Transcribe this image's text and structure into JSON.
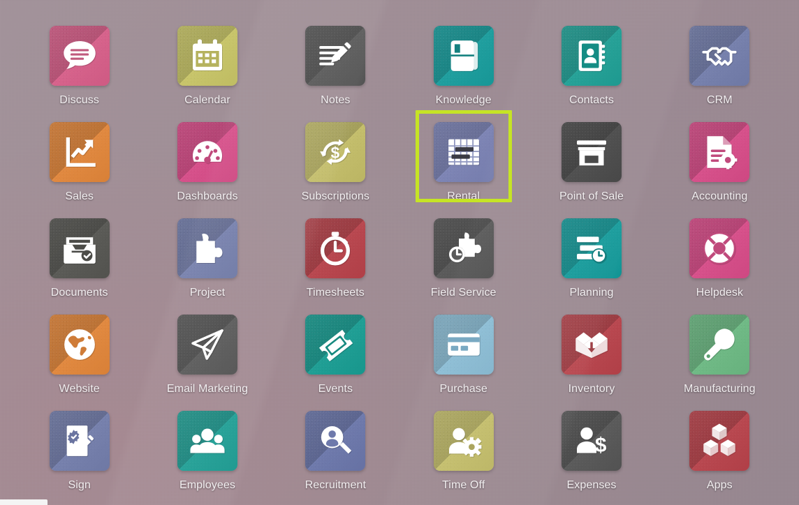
{
  "desktop": {
    "background_color": "#9e8c94",
    "highlight_color": "#c6e425",
    "label_color": "#f2eef0"
  },
  "apps": [
    {
      "name": "Discuss",
      "icon": "chat-bubble-icon",
      "color": "#d6628b",
      "selected": false
    },
    {
      "name": "Calendar",
      "icon": "calendar-icon",
      "color": "#c7c46a",
      "selected": false
    },
    {
      "name": "Notes",
      "icon": "notes-pencil-icon",
      "color": "#5a5a5a",
      "selected": false
    },
    {
      "name": "Knowledge",
      "icon": "book-icon",
      "color": "#1f9e9e",
      "selected": false
    },
    {
      "name": "Contacts",
      "icon": "address-book-icon",
      "color": "#1f9e94",
      "selected": false
    },
    {
      "name": "CRM",
      "icon": "handshake-icon",
      "color": "#7680ac",
      "selected": false
    },
    {
      "name": "Sales",
      "icon": "line-chart-icon",
      "color": "#e0883f",
      "selected": false
    },
    {
      "name": "Dashboards",
      "icon": "gauge-icon",
      "color": "#d6508a",
      "selected": false
    },
    {
      "name": "Subscriptions",
      "icon": "recycle-dollar-icon",
      "color": "#c3bd6b",
      "selected": false
    },
    {
      "name": "Rental",
      "icon": "gantt-icon",
      "color": "#7d84b4",
      "selected": true
    },
    {
      "name": "Point of Sale",
      "icon": "storefront-icon",
      "color": "#4a4a4a",
      "selected": false
    },
    {
      "name": "Accounting",
      "icon": "invoice-gear-icon",
      "color": "#d6508a",
      "selected": false
    },
    {
      "name": "Documents",
      "icon": "file-tray-check-icon",
      "color": "#5a5a56",
      "selected": false
    },
    {
      "name": "Project",
      "icon": "puzzle-piece-icon",
      "color": "#7680ac",
      "selected": false
    },
    {
      "name": "Timesheets",
      "icon": "stopwatch-icon",
      "color": "#b8474f",
      "selected": false
    },
    {
      "name": "Field Service",
      "icon": "puzzle-clock-icon",
      "color": "#5a5a5a",
      "selected": false
    },
    {
      "name": "Planning",
      "icon": "bars-clock-icon",
      "color": "#179b9b",
      "selected": false
    },
    {
      "name": "Helpdesk",
      "icon": "life-ring-icon",
      "color": "#d6508a",
      "selected": false
    },
    {
      "name": "Website",
      "icon": "globe-icon",
      "color": "#e0883f",
      "selected": false
    },
    {
      "name": "Email Marketing",
      "icon": "paper-plane-icon",
      "color": "#5a5a5a",
      "selected": false
    },
    {
      "name": "Events",
      "icon": "ticket-icon",
      "color": "#1f9e94",
      "selected": false
    },
    {
      "name": "Purchase",
      "icon": "credit-card-icon",
      "color": "#8bbcd4",
      "selected": false
    },
    {
      "name": "Inventory",
      "icon": "open-box-icon",
      "color": "#b8474f",
      "selected": false
    },
    {
      "name": "Manufacturing",
      "icon": "wrench-icon",
      "color": "#6fb985",
      "selected": false
    },
    {
      "name": "Sign",
      "icon": "signature-doc-icon",
      "color": "#7680ac",
      "selected": false
    },
    {
      "name": "Employees",
      "icon": "people-group-icon",
      "color": "#1f9e94",
      "selected": false
    },
    {
      "name": "Recruitment",
      "icon": "magnifier-person-icon",
      "color": "#6e79ab",
      "selected": false
    },
    {
      "name": "Time Off",
      "icon": "person-gear-icon",
      "color": "#c3bd6b",
      "selected": false
    },
    {
      "name": "Expenses",
      "icon": "person-dollar-icon",
      "color": "#5a5a5a",
      "selected": false
    },
    {
      "name": "Apps",
      "icon": "cubes-icon",
      "color": "#b8474f",
      "selected": false
    }
  ],
  "status_bar": {
    "visible": true
  }
}
